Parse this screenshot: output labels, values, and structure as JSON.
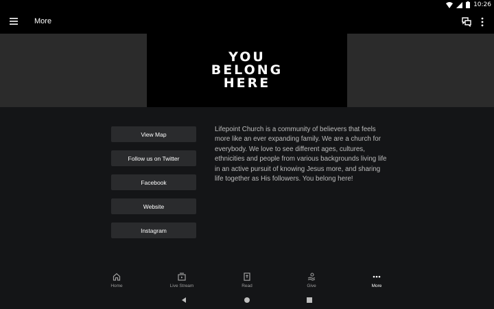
{
  "status_bar": {
    "time": "10:26"
  },
  "app_bar": {
    "title": "More"
  },
  "hero": {
    "lines": [
      "YOU",
      "BELONG",
      "HERE"
    ]
  },
  "links": [
    {
      "label": "View Map"
    },
    {
      "label": "Follow us on Twitter"
    },
    {
      "label": "Facebook"
    },
    {
      "label": "Website"
    },
    {
      "label": "Instagram"
    }
  ],
  "about_text": "Lifepoint Church is a community of believers that feels more like an ever expanding family. We are a church for everybody. We love to see different ages, cultures, ethnicities and people from various backgrounds living life in an active pursuit of knowing Jesus more, and sharing life together as His followers. You belong here!",
  "bottom_nav": [
    {
      "label": "Home",
      "icon": "home-icon"
    },
    {
      "label": "Live Stream",
      "icon": "live-stream-icon"
    },
    {
      "label": "Read",
      "icon": "bible-icon"
    },
    {
      "label": "Give",
      "icon": "give-icon"
    },
    {
      "label": "More",
      "icon": "more-dots-icon",
      "active": true
    }
  ],
  "colors": {
    "background": "#141517",
    "bar": "#000000",
    "button": "#2a2b2d",
    "text_muted": "#bdbdbd",
    "hero_side": "#2b2b2b"
  }
}
